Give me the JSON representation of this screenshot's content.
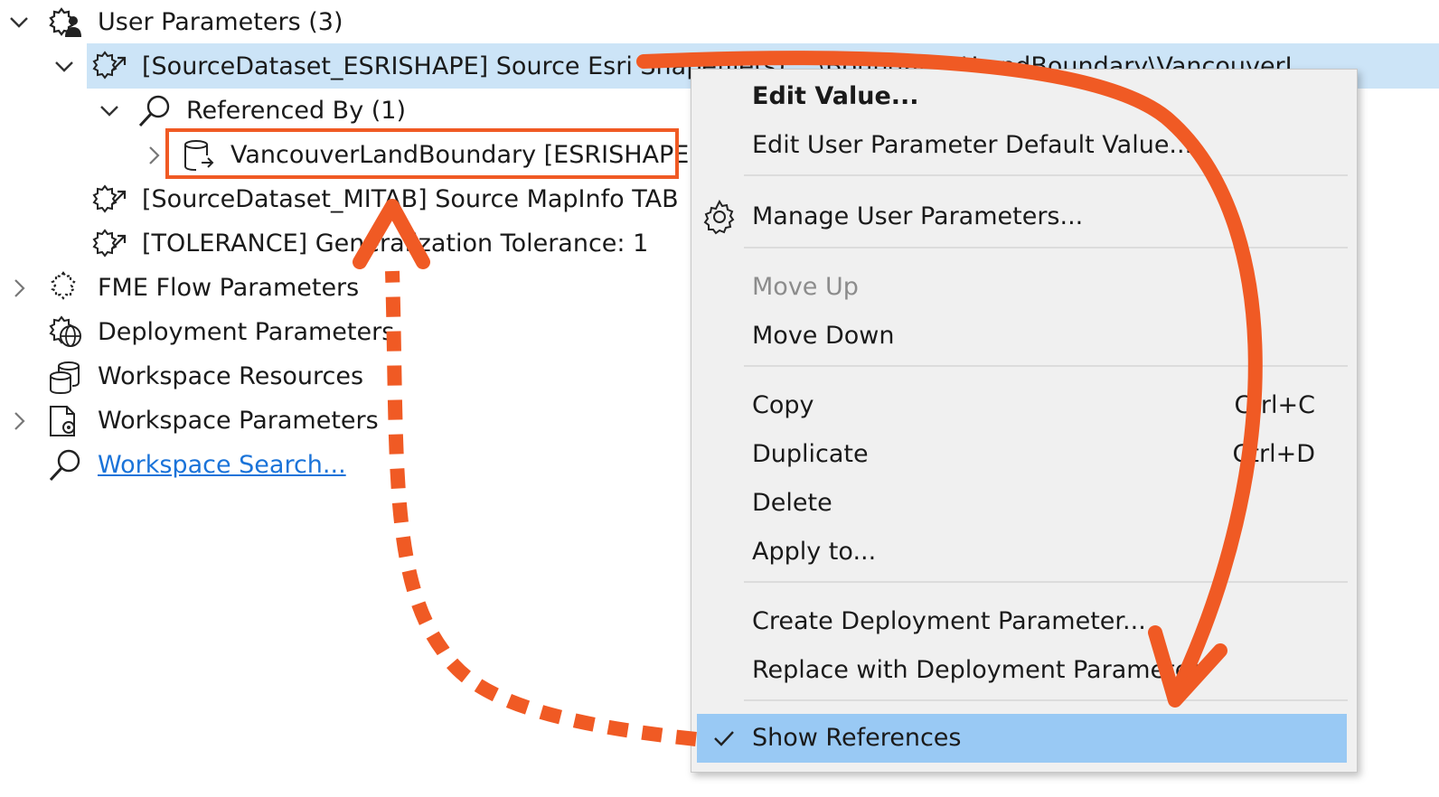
{
  "tree": {
    "user_parameters": "User Parameters (3)",
    "source_esri": "[SourceDataset_ESRISHAPE] Source Esri Shapefile(s): ..\\Boundaries\\LandBoundary\\VancouverL",
    "referenced_by": "Referenced By (1)",
    "vancouver_land_boundary": "VancouverLandBoundary [ESRISHAPE]",
    "source_mitab": "[SourceDataset_MITAB] Source MapInfo TAB Fi",
    "tolerance": "[TOLERANCE] Generalization Tolerance: 1",
    "fme_flow_parameters": "FME Flow Parameters",
    "deployment_parameters": "Deployment Parameters",
    "workspace_resources": "Workspace Resources",
    "workspace_parameters": "Workspace Parameters",
    "workspace_search": "Workspace Search..."
  },
  "context_menu": {
    "edit_value": "Edit Value...",
    "edit_default": "Edit User Parameter Default Value...",
    "manage": "Manage User Parameters...",
    "move_up": "Move Up",
    "move_down": "Move Down",
    "copy": "Copy",
    "copy_shortcut": "Ctrl+C",
    "duplicate": "Duplicate",
    "duplicate_shortcut": "Ctrl+D",
    "delete": "Delete",
    "apply_to": "Apply to...",
    "create_deployment": "Create Deployment Parameter...",
    "replace_deployment": "Replace with Deployment Parameter",
    "show_references": "Show References"
  },
  "colors": {
    "annotation_orange": "#f05a24",
    "selection_blue": "#cce4f7",
    "menu_highlight": "#99c9f4",
    "link_blue": "#1a73d9"
  },
  "icons": [
    "chevron-down-icon",
    "chevron-right-icon",
    "user-parameters-icon",
    "parameter-icon",
    "search-icon",
    "dataset-reader-icon",
    "fme-flow-icon",
    "deployment-globe-icon",
    "workspace-resources-icon",
    "workspace-parameters-icon",
    "gear-icon",
    "check-icon"
  ]
}
